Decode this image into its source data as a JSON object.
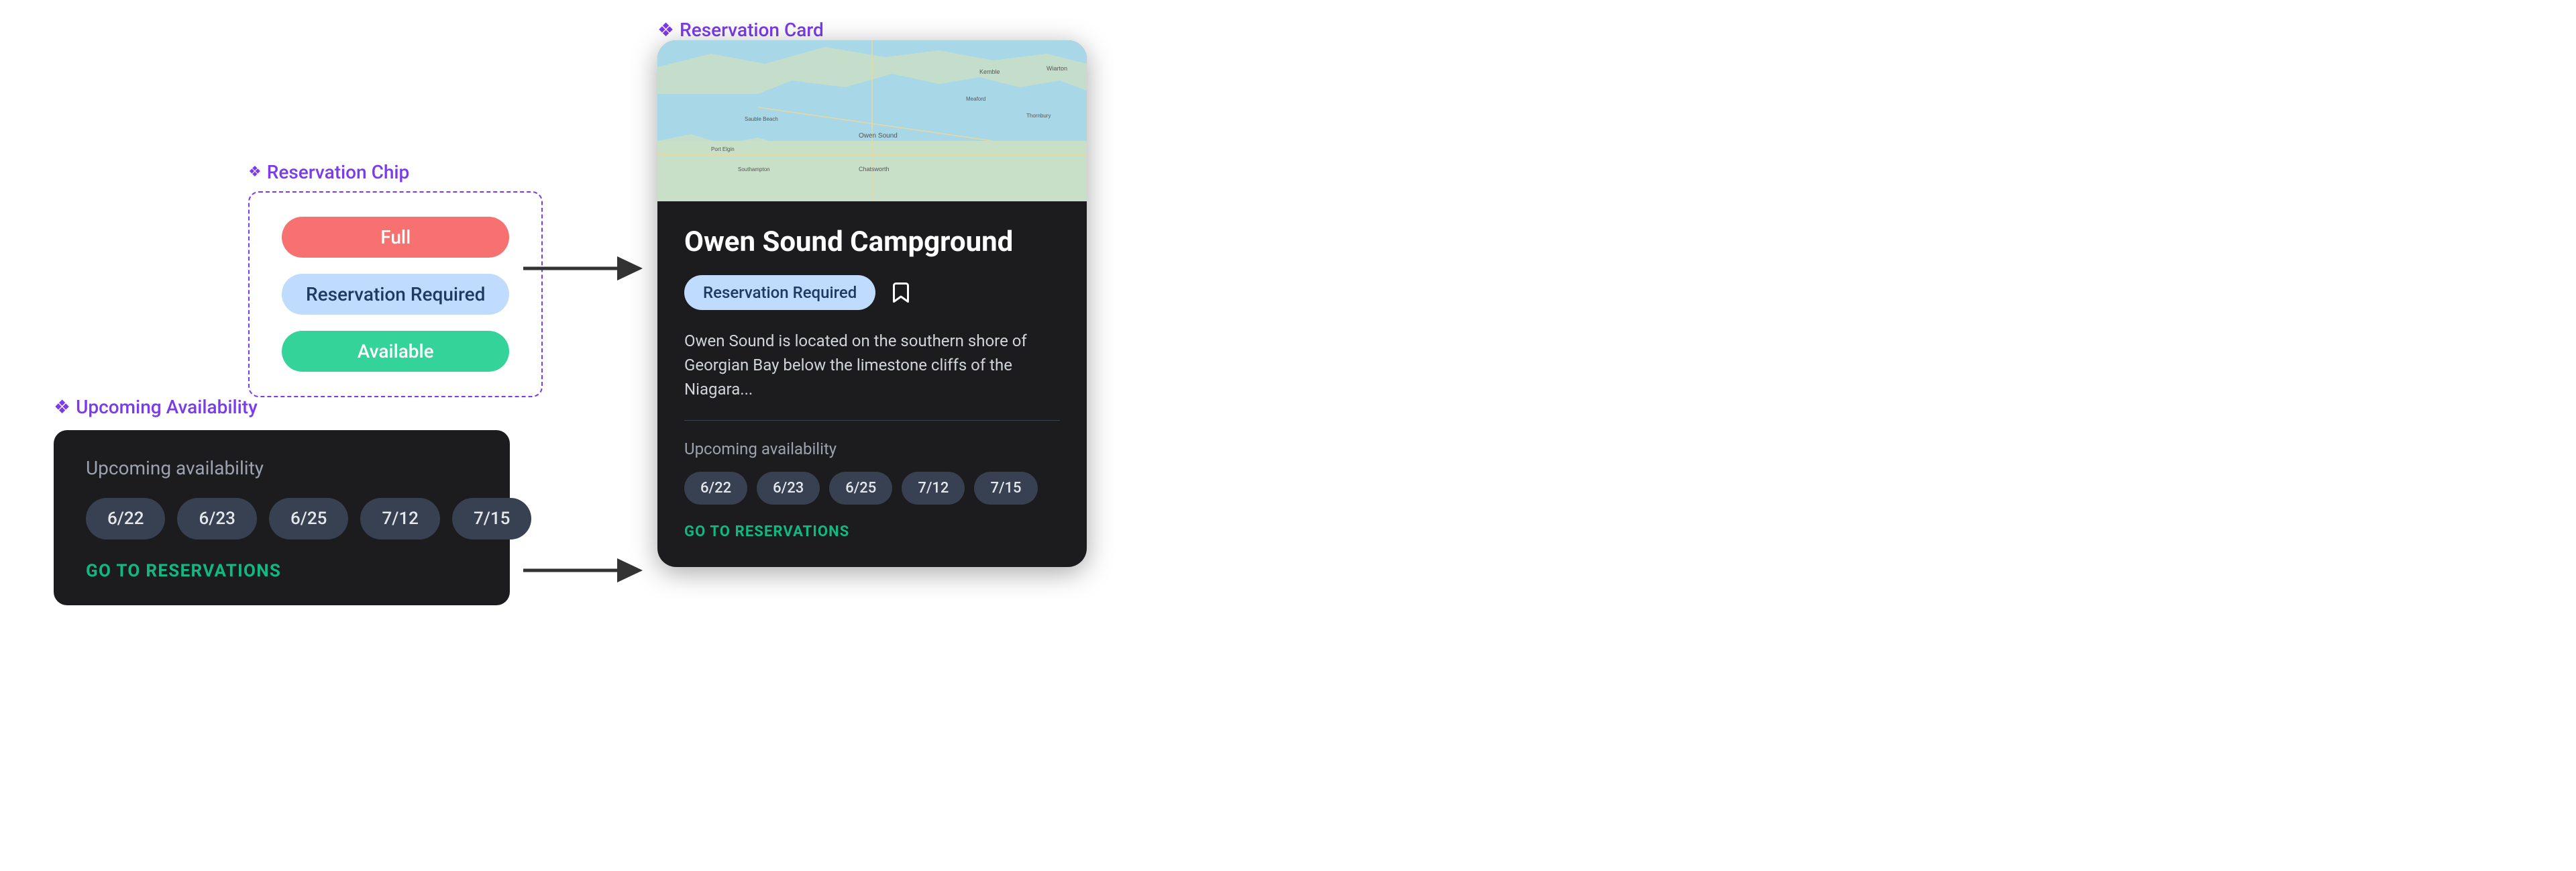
{
  "chip_section": {
    "label_icon": "❖",
    "label": "Reservation Chip",
    "chips": [
      {
        "text": "Full",
        "type": "full"
      },
      {
        "text": "Reservation Required",
        "type": "reservation"
      },
      {
        "text": "Available",
        "type": "available"
      }
    ]
  },
  "avail_section": {
    "label_icon": "❖",
    "label": "Upcoming Availability",
    "upcoming_text": "Upcoming availability",
    "dates": [
      "6/22",
      "6/23",
      "6/25",
      "7/12",
      "7/15"
    ],
    "go_label": "GO TO RESERVATIONS"
  },
  "card_section": {
    "label_icon": "❖",
    "label": "Reservation Card"
  },
  "reservation_card": {
    "title": "Owen Sound Campground",
    "reservation_chip": "Reservation Required",
    "description": "Owen Sound is located on the southern shore of Georgian Bay below the limestone cliffs of the Niagara...",
    "upcoming_text": "Upcoming availability",
    "dates": [
      "6/22",
      "6/23",
      "6/25",
      "7/12",
      "7/15"
    ],
    "go_label": "GO TO RESERVATIONS"
  },
  "arrows": [
    {
      "id": "arrow1",
      "label": "→"
    },
    {
      "id": "arrow2",
      "label": "→"
    }
  ]
}
